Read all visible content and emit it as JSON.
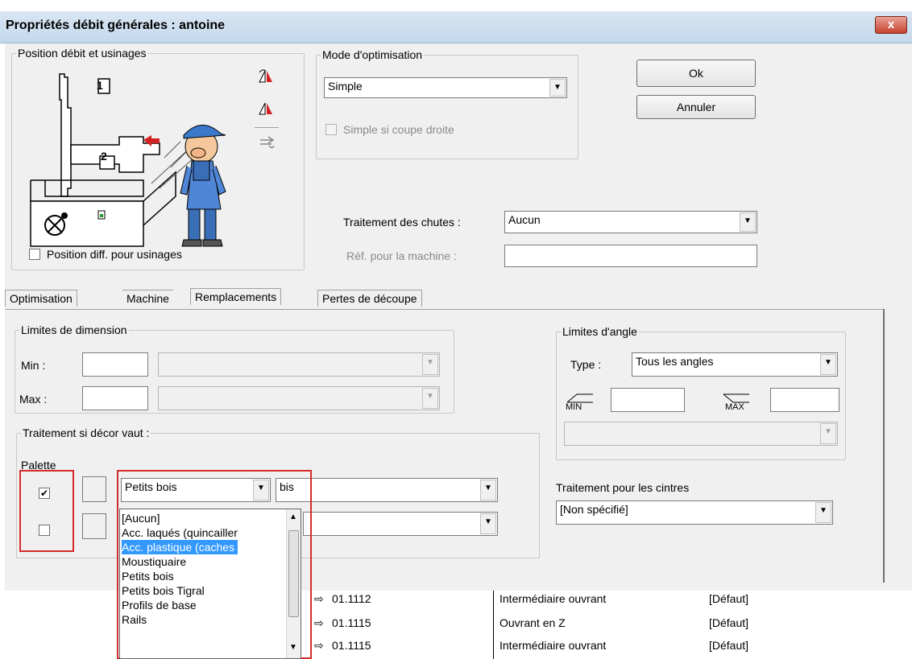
{
  "window": {
    "title": "Propriétés débit générales : antoine",
    "close_label": "x"
  },
  "position_group": {
    "legend": "Position débit et usinages",
    "label_1": "1",
    "label_2": "2",
    "checkbox_label": "Position diff. pour usinages"
  },
  "optim_mode": {
    "legend": "Mode d'optimisation",
    "selected": "Simple",
    "checkbox_label": "Simple si coupe droite"
  },
  "buttons": {
    "ok": "Ok",
    "cancel": "Annuler"
  },
  "chutes": {
    "label": "Traitement des chutes :",
    "value": "Aucun",
    "machine_ref_label": "Réf. pour la machine :",
    "machine_ref_value": ""
  },
  "tabs": [
    "Optimisation",
    "Machine",
    "Remplacements",
    "Pertes de découpe"
  ],
  "dim_limits": {
    "legend": "Limites de dimension",
    "min_label": "Min :",
    "max_label": "Max :"
  },
  "angle_limits": {
    "legend": "Limites d'angle",
    "type_label": "Type :",
    "type_value": "Tous les angles",
    "min_icon_label": "MIN",
    "max_icon_label": "MAX"
  },
  "decor": {
    "legend": "Traitement si décor vaut :",
    "palette_label": "Palette",
    "row1_checked": "✔",
    "row1_category": "Petits bois",
    "row1_value": "bis"
  },
  "cintres": {
    "label": "Traitement pour les cintres",
    "value": "[Non spécifié]"
  },
  "dropdown_items": [
    "[Aucun]",
    "Acc. laqués (quincailler",
    "Acc. plastique (caches",
    "Moustiquaire",
    "Petits bois",
    "Petits bois Tigral",
    "Profils de base",
    "Rails"
  ],
  "bg_rows": [
    {
      "code": "01.1112",
      "desc": "Intermédiaire ouvrant",
      "status": "[Défaut]"
    },
    {
      "code": "01.1115",
      "desc": "Ouvrant en Z",
      "status": "[Défaut]"
    },
    {
      "code": "01.1115",
      "desc": "Intermédiaire ouvrant",
      "status": "[Défaut]"
    }
  ],
  "colors": {
    "selection": "#3399ff",
    "highlight_box": "#d52b2b"
  }
}
